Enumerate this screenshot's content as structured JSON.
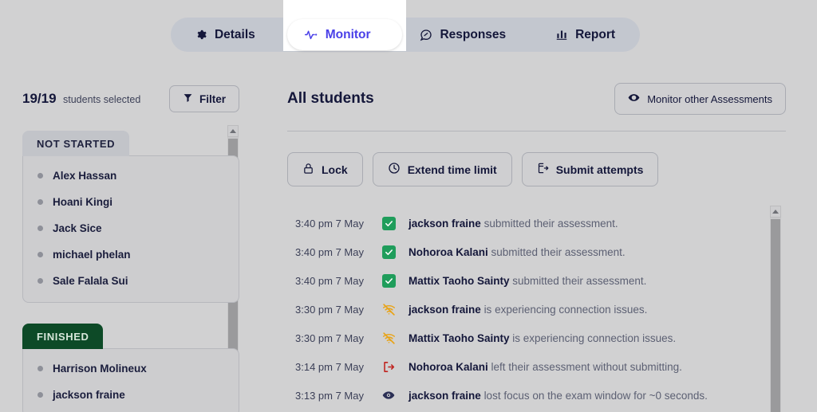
{
  "tabs": [
    {
      "label": "Details",
      "icon": "gear-icon",
      "active": false
    },
    {
      "label": "Monitor",
      "icon": "pulse-icon",
      "active": true
    },
    {
      "label": "Responses",
      "icon": "speech-bubble-icon",
      "active": false
    },
    {
      "label": "Report",
      "icon": "bar-chart-icon",
      "active": false
    }
  ],
  "sidebar": {
    "selected_count": "19/19",
    "selected_label": "students selected",
    "filter_label": "Filter",
    "groups": [
      {
        "title": "NOT STARTED",
        "style": "grey",
        "students": [
          "Alex Hassan",
          "Hoani Kingi",
          "Jack Sice",
          "michael phelan",
          "Sale Falala Sui"
        ]
      },
      {
        "title": "FINISHED",
        "style": "green",
        "students": [
          "Harrison Molineux",
          "jackson fraine"
        ]
      }
    ]
  },
  "main": {
    "page_title": "All students",
    "monitor_other_label": "Monitor other Assessments",
    "actions": [
      {
        "label": "Lock",
        "icon": "lock-icon"
      },
      {
        "label": "Extend time limit",
        "icon": "clock-icon"
      },
      {
        "label": "Submit attempts",
        "icon": "submit-document-icon"
      }
    ],
    "events": [
      {
        "time": "3:40 pm 7 May",
        "icon": "check-square-icon",
        "name": "jackson fraine",
        "text": "submitted their assessment."
      },
      {
        "time": "3:40 pm 7 May",
        "icon": "check-square-icon",
        "name": "Nohoroa Kalani",
        "text": "submitted their assessment."
      },
      {
        "time": "3:40 pm 7 May",
        "icon": "check-square-icon",
        "name": "Mattix Taoho Sainty",
        "text": "submitted their assessment."
      },
      {
        "time": "3:30 pm 7 May",
        "icon": "wifi-off-icon",
        "name": "jackson fraine",
        "text": "is experiencing connection issues."
      },
      {
        "time": "3:30 pm 7 May",
        "icon": "wifi-off-icon",
        "name": "Mattix Taoho Sainty",
        "text": "is experiencing connection issues."
      },
      {
        "time": "3:14 pm 7 May",
        "icon": "exit-icon",
        "name": "Nohoroa Kalani",
        "text": "left their assessment without submitting."
      },
      {
        "time": "3:13 pm 7 May",
        "icon": "eye-icon",
        "name": "jackson fraine",
        "text": "lost focus on the exam window for ~0 seconds."
      }
    ]
  },
  "colors": {
    "accent": "#4a40e8",
    "success": "#1f9d5b",
    "warning": "#e8a317",
    "danger": "#c0231f",
    "finished_header": "#0d4a27",
    "page_bg": "#d1d1d2"
  }
}
